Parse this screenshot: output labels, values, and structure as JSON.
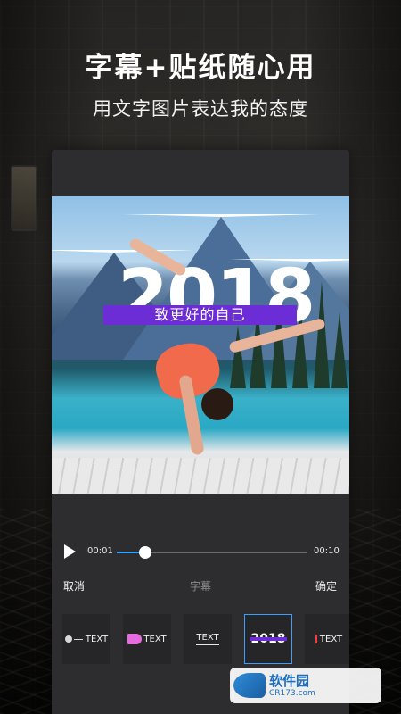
{
  "promo": {
    "headline": "字幕+贴纸随心用",
    "subheadline": "用文字图片表达我的态度"
  },
  "preview": {
    "year_text": "2018",
    "banner_text": "致更好的自己",
    "banner_color": "#6c2cd6"
  },
  "playback": {
    "current_time": "00:01",
    "total_time": "00:10",
    "progress": 0.15,
    "accent_color": "#34a3ff",
    "play_icon": "play-icon"
  },
  "actions": {
    "cancel_label": "取消",
    "section_label": "字幕",
    "confirm_label": "确定"
  },
  "subtitle_styles": [
    {
      "id": "pin-text",
      "label": "TEXT",
      "icon": "pin-icon",
      "selected": false
    },
    {
      "id": "megaphone-text",
      "label": "TEXT",
      "icon": "megaphone-icon",
      "selected": false
    },
    {
      "id": "underlined-text",
      "label": "TEXT",
      "icon": "underline-icon",
      "selected": false
    },
    {
      "id": "year-banner",
      "label": "2018",
      "icon": "banner-icon",
      "selected": true
    },
    {
      "id": "bar-text",
      "label": "TEXT",
      "icon": "bar-icon",
      "selected": false
    }
  ],
  "watermark": {
    "brand": "软件园",
    "url": "CR173.com"
  }
}
